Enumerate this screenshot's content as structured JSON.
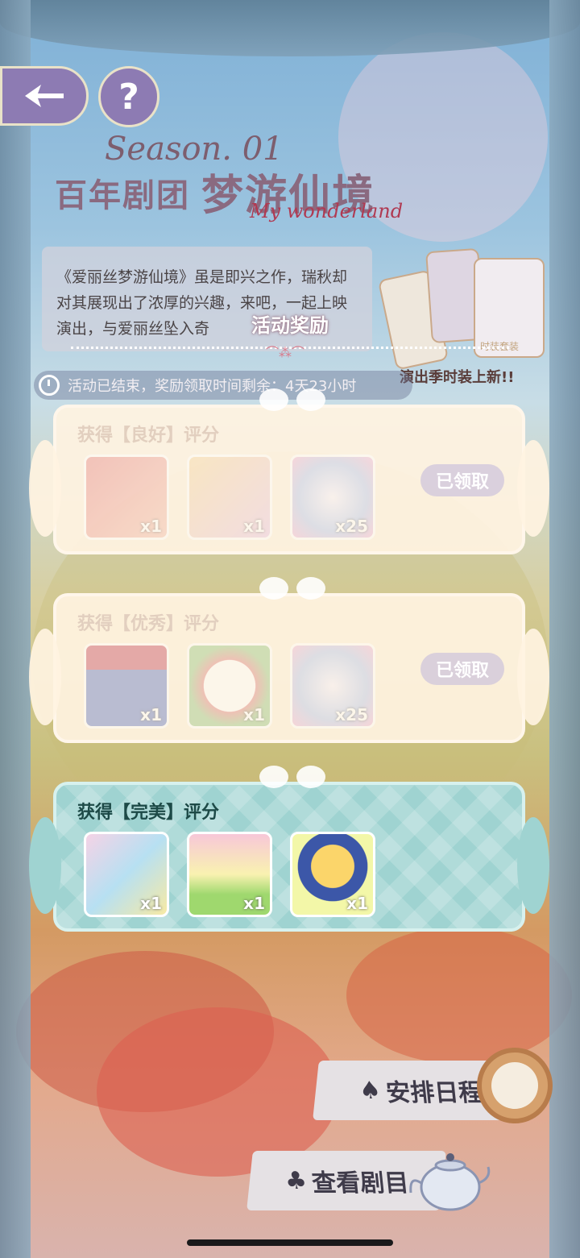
{
  "header": {
    "back_icon": "back-arrow-icon",
    "help_label": "?"
  },
  "title": {
    "number": "01",
    "season": "Season.",
    "troupe": "百年剧团",
    "event_name": "梦游仙境",
    "script_text": "My wonderland"
  },
  "description": {
    "text": "《爱丽丝梦游仙境》虽是即兴之作，瑞秋却对其展现出了浓厚的兴趣，来吧，一起上映演出，与爱丽丝坠入奇"
  },
  "promo": {
    "banner": "演出季时装上新!!",
    "tag_label": "时装套装"
  },
  "rewards_section": {
    "title": "活动奖励"
  },
  "timer": {
    "text": "活动已结束，奖励领取时间剩余：4天23小时"
  },
  "reward_tiers": [
    {
      "title": "获得【良好】评分",
      "status": "已领取",
      "items": [
        {
          "icon": "stage-curtain-icon",
          "qty": "x1"
        },
        {
          "icon": "flying-carpet-icon",
          "qty": "x1"
        },
        {
          "icon": "rainbow-flower-icon",
          "qty": "x25"
        }
      ]
    },
    {
      "title": "获得【优秀】评分",
      "status": "已领取",
      "items": [
        {
          "icon": "blue-curtain-icon",
          "qty": "x1"
        },
        {
          "icon": "flower-frame-icon",
          "qty": "x1"
        },
        {
          "icon": "rainbow-flower-icon",
          "qty": "x25"
        }
      ]
    },
    {
      "title": "获得【完美】评分",
      "items": [
        {
          "icon": "card-backdrop-icon",
          "qty": "x1"
        },
        {
          "icon": "green-floor-icon",
          "qty": "x1"
        },
        {
          "icon": "alice-avatar-icon",
          "qty": "x1"
        }
      ]
    }
  ],
  "actions": {
    "schedule_label": "安排日程",
    "view_label": "查看剧目",
    "spade_icon": "♠",
    "club_icon": "♣"
  },
  "colors": {
    "claimed_card": "#fff3e1",
    "perfect_card": "#9fd3d1",
    "badge": "#c8bedc",
    "button_purple": "#8d7bb3"
  }
}
